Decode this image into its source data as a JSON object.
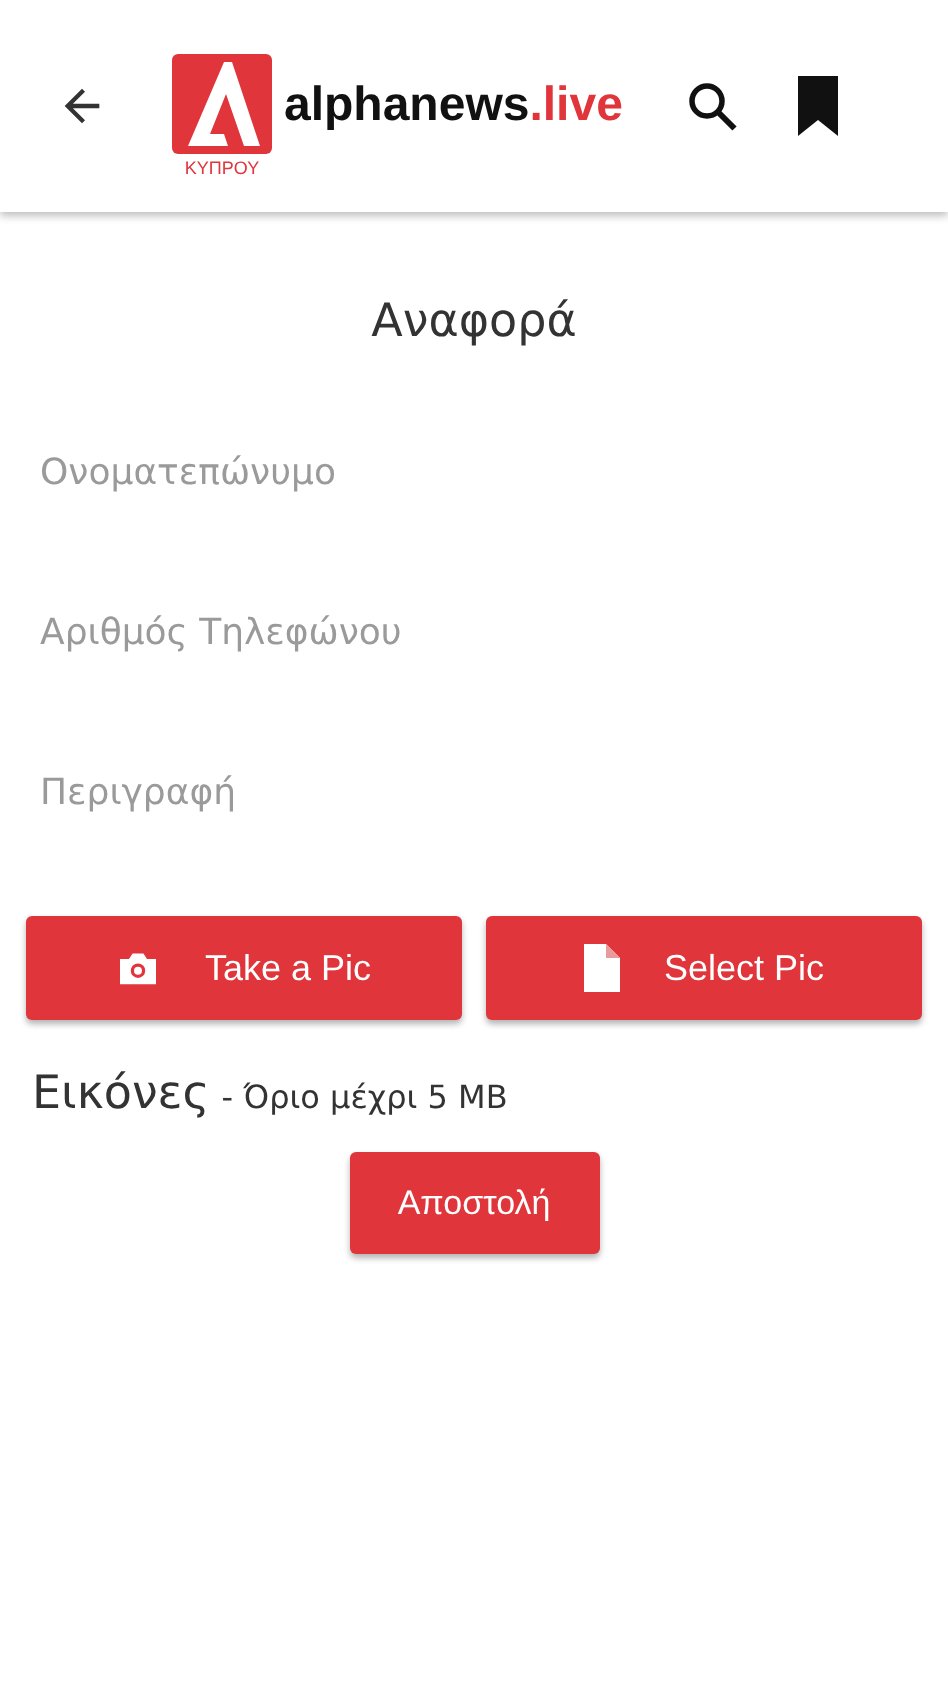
{
  "app_bar": {
    "logo_caption": "ΚΥΠΡΟΥ",
    "brand_name": "alphanews",
    "brand_suffix": ".live"
  },
  "form": {
    "title": "Αναφορά",
    "fields": [
      {
        "placeholder": "Ονοματεπώνυμο"
      },
      {
        "placeholder": "Αριθμός Τηλεφώνου"
      },
      {
        "placeholder": "Περιγραφή"
      }
    ],
    "photo_buttons": [
      {
        "kind": "camera",
        "label": "Take a Pic"
      },
      {
        "kind": "file",
        "label": "Select Pic"
      }
    ],
    "images_title": "Εικόνες",
    "images_note": "- Όριο μέχρι 5 MB",
    "submit": "Αποστολή"
  }
}
